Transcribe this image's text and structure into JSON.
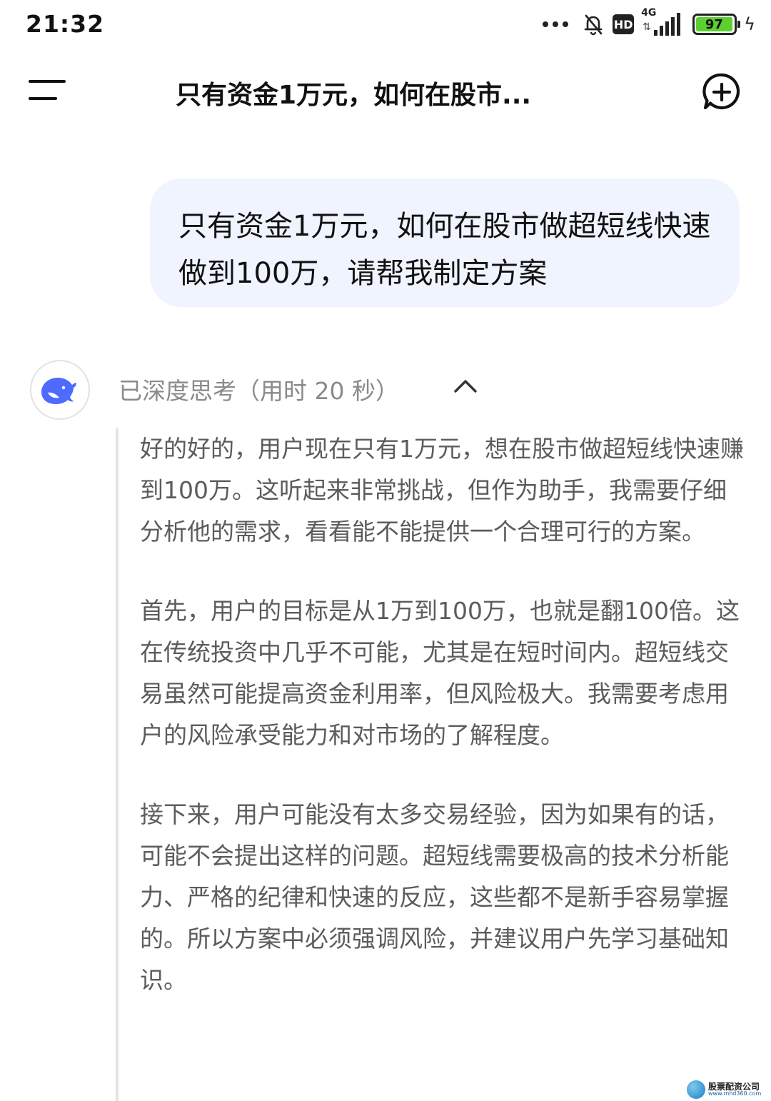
{
  "status_bar": {
    "time": "21:32",
    "network": "4G",
    "hd_label": "HD",
    "battery": "97",
    "battery_color": "#5bd12f",
    "icons": [
      "more-dots-icon",
      "bell-off-icon",
      "hd-icon",
      "signal-icon",
      "battery-icon",
      "charging-bolt-icon"
    ]
  },
  "header": {
    "title": "只有资金1万元，如何在股市...",
    "menu_icon": "menu-icon",
    "new_chat_icon": "new-chat-plus-icon"
  },
  "conversation": {
    "user_message": "只有资金1万元，如何在股市做超短线快速做到100万，请帮我制定方案",
    "user_bubble_color": "#eff4fe",
    "assistant": {
      "avatar_icon": "whale-logo-icon",
      "brand_color": "#4d6bfe",
      "thinking_label": "已深度思考（用时 20 秒）",
      "collapse_icon": "chevron-up-icon",
      "thinking_paragraphs": [
        "好的好的，用户现在只有1万元，想在股市做超短线快速赚到100万。这听起来非常挑战，但作为助手，我需要仔细分析他的需求，看看能不能提供一个合理可行的方案。",
        "首先，用户的目标是从1万到100万，也就是翻100倍。这在传统投资中几乎不可能，尤其是在短时间内。超短线交易虽然可能提高资金利用率，但风险极大。我需要考虑用户的风险承受能力和对市场的了解程度。",
        "接下来，用户可能没有太多交易经验，因为如果有的话，可能不会提出这样的问题。超短线需要极高的技术分析能力、严格的纪律和快速的反应，这些都不是新手容易掌握的。所以方案中必须强调风险，并建议用户先学习基础知识。"
      ]
    }
  },
  "watermark": {
    "title": "股票配资公司",
    "url": "www.mhd360.com"
  }
}
